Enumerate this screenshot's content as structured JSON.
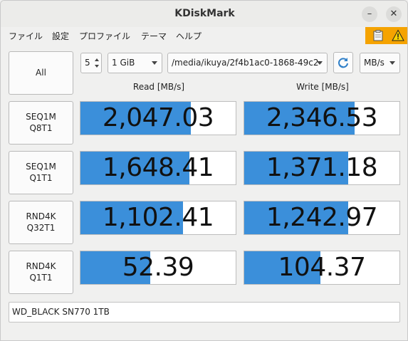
{
  "window": {
    "title": "KDiskMark",
    "minimize": "–",
    "close": "✕"
  },
  "menu": [
    "ファイル",
    "設定",
    "プロファイル",
    "テーマ",
    "ヘルプ"
  ],
  "indicators": [
    "clipboard-icon",
    "warning-icon"
  ],
  "colors": {
    "bar_fill": "#3b8fda",
    "warning_bg": "#f5a300"
  },
  "controls": {
    "all_label": "All",
    "runs": "5",
    "size": "1 GiB",
    "path": "/media/ikuya/2f4b1ac0-1868-49c2-",
    "unit": "MB/s"
  },
  "headers": {
    "read": "Read [MB/s]",
    "write": "Write [MB/s]"
  },
  "tests": [
    {
      "label": "SEQ1M\nQ8T1",
      "read": "2,047.03",
      "write": "2,346.53",
      "read_fill": 0.71,
      "write_fill": 0.71
    },
    {
      "label": "SEQ1M\nQ1T1",
      "read": "1,648.41",
      "write": "1,371.18",
      "read_fill": 0.7,
      "write_fill": 0.67
    },
    {
      "label": "RND4K\nQ32T1",
      "read": "1,102.41",
      "write": "1,242.97",
      "read_fill": 0.66,
      "write_fill": 0.67
    },
    {
      "label": "RND4K\nQ1T1",
      "read": "52.39",
      "write": "104.37",
      "read_fill": 0.45,
      "write_fill": 0.49
    }
  ],
  "device": "WD_BLACK SN770 1TB"
}
